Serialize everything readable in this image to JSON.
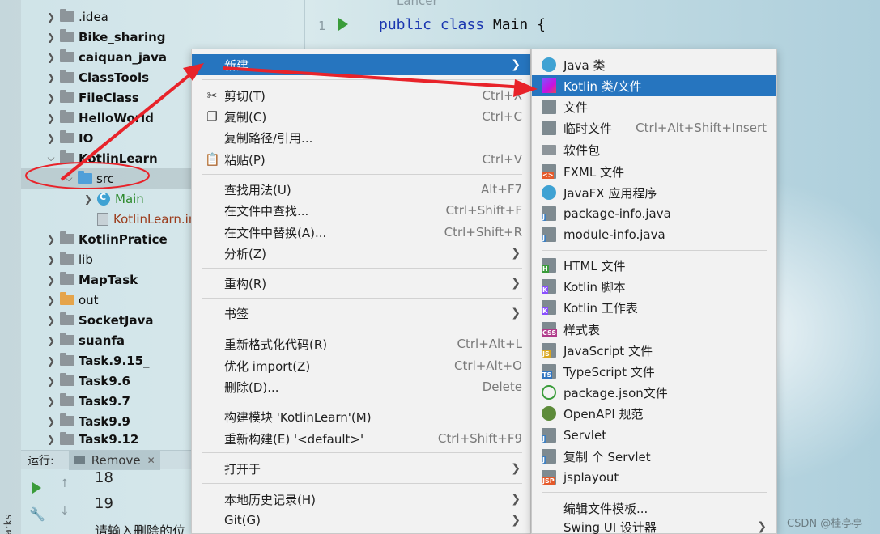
{
  "editor": {
    "line_number": "1",
    "code_keyword_1": "public",
    "code_keyword_2": "class",
    "code_rest": "Main {",
    "faded_text": "Lancer"
  },
  "project_tree": [
    {
      "label": ".idea",
      "bold": false,
      "kind": "folder"
    },
    {
      "label": "Bike_sharing",
      "bold": true,
      "kind": "folder"
    },
    {
      "label": "caiquan_java",
      "bold": true,
      "kind": "folder"
    },
    {
      "label": "ClassTools",
      "bold": true,
      "kind": "folder"
    },
    {
      "label": "FileClass",
      "bold": true,
      "kind": "folder"
    },
    {
      "label": "HelloWorld",
      "bold": true,
      "kind": "folder"
    },
    {
      "label": "IO",
      "bold": true,
      "kind": "folder"
    },
    {
      "label": "KotlinLearn",
      "bold": true,
      "kind": "folder-open"
    },
    {
      "label": "src",
      "bold": false,
      "kind": "src"
    },
    {
      "label": "Main",
      "bold": false,
      "kind": "class"
    },
    {
      "label": "KotlinLearn.iml",
      "bold": false,
      "kind": "iml"
    },
    {
      "label": "KotlinPratice",
      "bold": true,
      "kind": "folder"
    },
    {
      "label": "lib",
      "bold": false,
      "kind": "folder"
    },
    {
      "label": "MapTask",
      "bold": true,
      "kind": "folder"
    },
    {
      "label": "out",
      "bold": false,
      "kind": "out"
    },
    {
      "label": "SocketJava",
      "bold": true,
      "kind": "folder"
    },
    {
      "label": "suanfa",
      "bold": true,
      "kind": "folder"
    },
    {
      "label": "Task.9.15_",
      "bold": true,
      "kind": "folder"
    },
    {
      "label": "Task9.6",
      "bold": true,
      "kind": "folder"
    },
    {
      "label": "Task9.7",
      "bold": true,
      "kind": "folder"
    },
    {
      "label": "Task9.9",
      "bold": true,
      "kind": "folder"
    },
    {
      "label": "Task9.12",
      "bold": true,
      "kind": "folder"
    }
  ],
  "run_panel": {
    "label": "运行:",
    "tab": "Remove",
    "output": [
      "18",
      "19",
      "请输入删除的位"
    ],
    "side_label": "arks"
  },
  "context_menu": {
    "new": "新建",
    "cut": "剪切(T)",
    "cut_sc": "Ctrl+X",
    "copy": "复制(C)",
    "copy_sc": "Ctrl+C",
    "copy_path": "复制路径/引用...",
    "paste": "粘贴(P)",
    "paste_sc": "Ctrl+V",
    "find_usages": "查找用法(U)",
    "find_usages_sc": "Alt+F7",
    "find_in_files": "在文件中查找...",
    "find_in_files_sc": "Ctrl+Shift+F",
    "replace_in_files": "在文件中替换(A)...",
    "replace_in_files_sc": "Ctrl+Shift+R",
    "analyze": "分析(Z)",
    "refactor": "重构(R)",
    "bookmarks": "书签",
    "reformat": "重新格式化代码(R)",
    "reformat_sc": "Ctrl+Alt+L",
    "optimize_imports": "优化 import(Z)",
    "optimize_imports_sc": "Ctrl+Alt+O",
    "delete": "删除(D)...",
    "delete_sc": "Delete",
    "build_module": "构建模块 'KotlinLearn'(M)",
    "rebuild": "重新构建(E) '<default>'",
    "rebuild_sc": "Ctrl+Shift+F9",
    "open_in": "打开于",
    "local_history": "本地历史记录(H)",
    "git": "Git(G)"
  },
  "submenu": {
    "java_class": "Java 类",
    "kotlin_class": "Kotlin 类/文件",
    "file": "文件",
    "scratch": "临时文件",
    "scratch_sc": "Ctrl+Alt+Shift+Insert",
    "package": "软件包",
    "fxml": "FXML 文件",
    "javafx": "JavaFX 应用程序",
    "package_info": "package-info.java",
    "module_info": "module-info.java",
    "html": "HTML 文件",
    "kotlin_script": "Kotlin 脚本",
    "kotlin_worksheet": "Kotlin 工作表",
    "stylesheet": "样式表",
    "javascript": "JavaScript 文件",
    "typescript": "TypeScript 文件",
    "package_json": "package.json文件",
    "openapi": "OpenAPI 规范",
    "servlet": "Servlet",
    "copy_servlet": "复制 个 Servlet",
    "jsplayout": "jsplayout",
    "edit_templates": "编辑文件模板...",
    "swing_designer": "Swing UI 设计器"
  },
  "watermark": "CSDN @桂亭亭",
  "colors": {
    "menu_highlight": "#2675bf",
    "annotation": "#e8232a"
  }
}
